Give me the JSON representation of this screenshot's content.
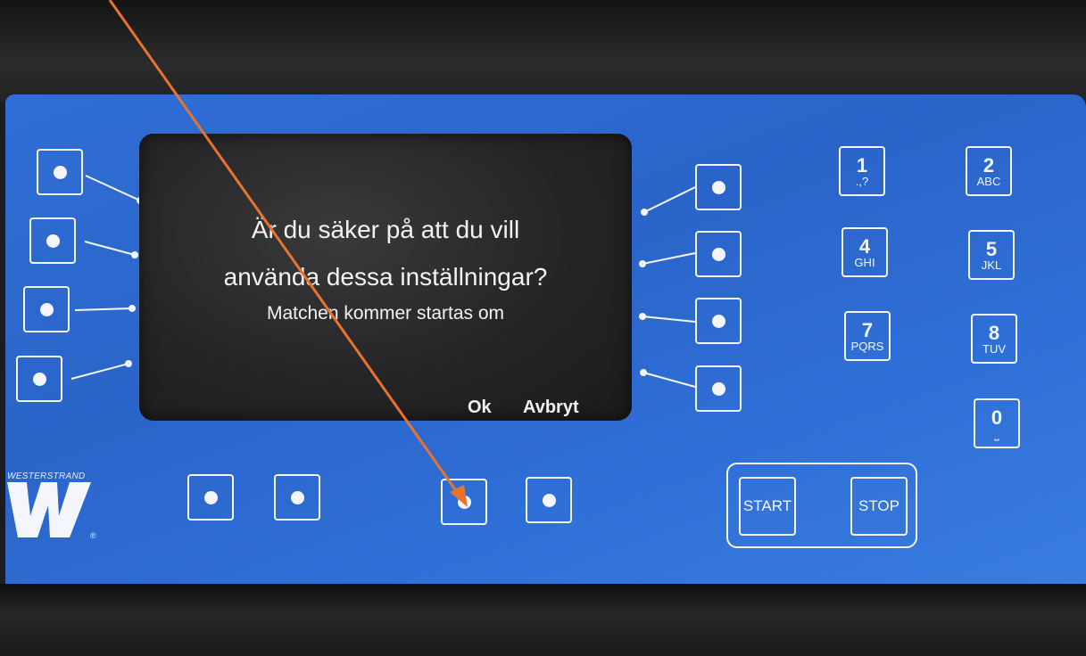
{
  "dialog": {
    "question_line1": "Är du säker på att du vill",
    "question_line2": "använda dessa inställningar?",
    "message": "Matchen kommer startas om",
    "ok_label": "Ok",
    "cancel_label": "Avbryt"
  },
  "keypad": [
    {
      "digit": "1",
      "letters": ".,?"
    },
    {
      "digit": "2",
      "letters": "ABC"
    },
    {
      "digit": "4",
      "letters": "GHI"
    },
    {
      "digit": "5",
      "letters": "JKL"
    },
    {
      "digit": "7",
      "letters": "PQRS"
    },
    {
      "digit": "8",
      "letters": "TUV"
    },
    {
      "digit": "0",
      "letters": "⎵"
    }
  ],
  "controls": {
    "start_label": "START",
    "stop_label": "STOP"
  },
  "brand": {
    "name": "WESTERSTRAND",
    "logo_letter": "W",
    "registered": "®"
  },
  "annotation": {
    "arrow_color": "#e8732f",
    "points_to": "soft-key-ok-button"
  },
  "colors": {
    "panel_blue": "#2f6fd6",
    "screen_dark": "#252527",
    "button_outline": "#f4f6fb"
  }
}
